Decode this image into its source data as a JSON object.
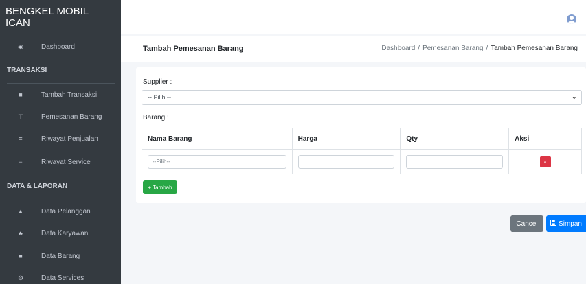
{
  "brand": "BENGKEL MOBIL ICAN",
  "sidebar": {
    "dashboard": "Dashboard",
    "section_transaksi": "TRANSAKSI",
    "transaksi_items": [
      {
        "label": "Tambah Transaksi",
        "icon": "plus-square-icon"
      },
      {
        "label": "Pemesanan Barang",
        "icon": "cart-icon"
      },
      {
        "label": "Riwayat Penjualan",
        "icon": "list-icon"
      },
      {
        "label": "Riwayat Service",
        "icon": "list-icon"
      }
    ],
    "section_data": "DATA & LAPORAN",
    "data_items": [
      {
        "label": "Data Pelanggan",
        "icon": "user-icon"
      },
      {
        "label": "Data Karyawan",
        "icon": "users-icon"
      },
      {
        "label": "Data Barang",
        "icon": "box-icon"
      },
      {
        "label": "Data Services",
        "icon": "cogs-icon"
      }
    ]
  },
  "header": {
    "title": "Tambah Pemesanan Barang",
    "breadcrumb": [
      "Dashboard",
      "/",
      "Pemesanan Barang",
      "/",
      "Tambah Pemesanan Barang"
    ]
  },
  "form": {
    "supplier_label": "Supplier :",
    "supplier_value": "-- Pilih --",
    "barang_label": "Barang :",
    "columns": [
      "Nama Barang",
      "Harga",
      "Qty",
      "Aksi"
    ],
    "row": {
      "nama_placeholder": "--Pilih--",
      "harga": "",
      "qty": ""
    },
    "delete_icon": "×",
    "add_label": "Tambah",
    "add_icon": "+"
  },
  "actions": {
    "cancel": "Cancel",
    "save": "Simpan",
    "save_icon": "floppy-icon"
  },
  "colors": {
    "sidebar": "#343a40",
    "primary": "#007bff",
    "success": "#28a745",
    "danger": "#dc3545",
    "secondary": "#6c757d"
  }
}
